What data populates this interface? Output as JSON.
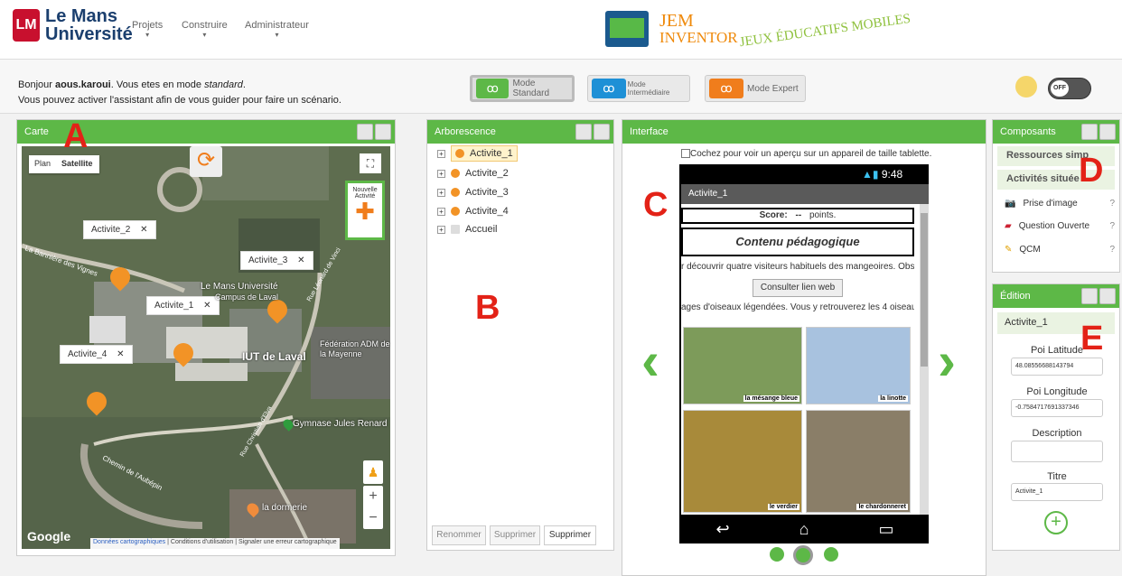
{
  "header": {
    "logo_letters": "LM",
    "university_line1": "Le Mans",
    "university_line2": "Université",
    "nav": [
      "Projets",
      "Construire",
      "Administrateur"
    ],
    "nav_caret": "▾",
    "jem_line1": "JEM",
    "jem_line2": "INVENTOR",
    "jem_subtitle": "JEUX ÉDUCATIFS MOBILES"
  },
  "message": {
    "greeting_prefix": "Bonjour ",
    "username": "aous.karoui",
    "mode_text": ". Vous etes en mode ",
    "mode_name": "standard",
    "mode_end": ".",
    "line2": "Vous pouvez activer l'assistant afin de vous guider pour faire un scénario."
  },
  "modes": {
    "standard": "Mode Standard",
    "intermediate": "Mode Intermédiaire",
    "expert": "Mode Expert"
  },
  "toggle_label": "OFF",
  "annotations": [
    "A",
    "B",
    "C",
    "D",
    "E"
  ],
  "map_panel": {
    "title": "Carte",
    "plan": "Plan",
    "satellite": "Satellite",
    "new_activity_line1": "Nouvelle",
    "new_activity_line2": "Activité",
    "activities": [
      "Activite_2",
      "Activite_3",
      "Activite_1",
      "Activite_4"
    ],
    "close_glyph": "✕",
    "places": [
      "Le Mans Université",
      "Campus de Laval",
      "IUT de Laval",
      "Fédération ADM de la Mayenne",
      "Gymnase Jules Renard",
      "la dormerie"
    ],
    "streets": [
      "La Bannière des Vignes",
      "Rue Léonard de Vinci",
      "Rue Christian d'Elva",
      "Chemin de l'Aubépin"
    ],
    "google": "Google",
    "footer": [
      "Données cartographiques",
      "Conditions d'utilisation",
      "Signaler une erreur cartographique"
    ],
    "zoom_in": "+",
    "zoom_out": "−"
  },
  "tree_panel": {
    "title": "Arborescence",
    "items": [
      "Activite_1",
      "Activite_2",
      "Activite_3",
      "Activite_4",
      "Accueil"
    ],
    "expand_glyph": "+",
    "buttons": [
      "Renommer",
      "Supprimer",
      "Supprimer"
    ]
  },
  "interface_panel": {
    "title": "Interface",
    "checkbox_label": "Cochez pour voir un aperçu sur un appareil de taille tablette.",
    "status_time": "9:48",
    "screen_title": "Activite_1",
    "score_label": "Score:",
    "score_value": "--",
    "score_unit": "points.",
    "content_title": "Contenu pédagogique",
    "text_line1": "r découvrir quatre visiteurs habituels des mangeoires. Obs",
    "link_button": "Consulter lien web",
    "text_line2": "ages d'oiseaux légendées. Vous y retrouverez les 4 oiseau",
    "birds": [
      "la mésange bleue",
      "la linotte",
      "le verdier",
      "le chardonneret"
    ],
    "nav_back": "↩",
    "nav_home": "⌂",
    "nav_recent": "▭"
  },
  "components_panel": {
    "title": "Composants",
    "section1": "Ressources simp",
    "section2": "Activités située",
    "items": [
      "Prise d'image",
      "Question Ouverte",
      "QCM"
    ],
    "help_glyph": "?"
  },
  "edition_panel": {
    "title": "Édition",
    "activity": "Activite_1",
    "lat_label": "Poi Latitude",
    "lat_value": "48.08556688143794",
    "lon_label": "Poi Longitude",
    "lon_value": "-0.7584717691337346",
    "desc_label": "Description",
    "desc_value": "",
    "title_label": "Titre",
    "title_value": "Activite_1",
    "add_glyph": "+"
  }
}
